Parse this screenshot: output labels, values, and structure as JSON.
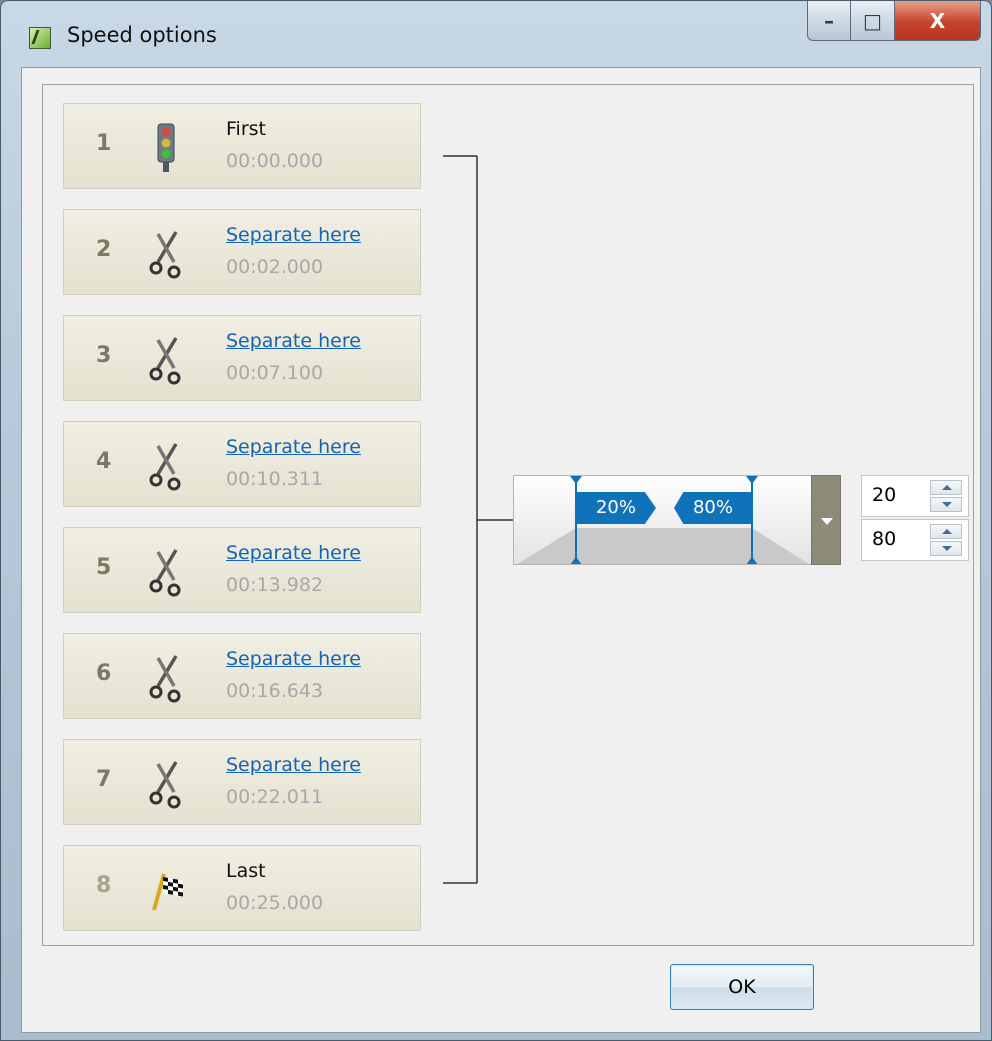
{
  "window": {
    "title": "Speed options",
    "controls": {
      "minimize": "–",
      "maximize": "□",
      "close": "X"
    }
  },
  "segments": [
    {
      "number": "1",
      "title": "First",
      "time": "00:00.000",
      "icon": "traffic-light-icon",
      "is_link": false
    },
    {
      "number": "2",
      "title": "Separate here",
      "time": "00:02.000",
      "icon": "scissors-icon",
      "is_link": true
    },
    {
      "number": "3",
      "title": "Separate here",
      "time": "00:07.100",
      "icon": "scissors-icon",
      "is_link": true
    },
    {
      "number": "4",
      "title": "Separate here",
      "time": "00:10.311",
      "icon": "scissors-icon",
      "is_link": true
    },
    {
      "number": "5",
      "title": "Separate here",
      "time": "00:13.982",
      "icon": "scissors-icon",
      "is_link": true
    },
    {
      "number": "6",
      "title": "Separate here",
      "time": "00:16.643",
      "icon": "scissors-icon",
      "is_link": true
    },
    {
      "number": "7",
      "title": "Separate here",
      "time": "00:22.011",
      "icon": "scissors-icon",
      "is_link": true
    },
    {
      "number": "8",
      "title": "Last",
      "time": "00:25.000",
      "icon": "checkered-flag-icon",
      "is_link": false
    }
  ],
  "speed_curve": {
    "left_label": "20%",
    "right_label": "80%",
    "left_value": 20,
    "right_value": 80
  },
  "spinners": {
    "start": "20",
    "end": "80"
  },
  "buttons": {
    "ok": "OK"
  },
  "colors": {
    "accent": "#1072b8",
    "link": "#1464b6",
    "segment_bg": "#e9e6d6"
  }
}
